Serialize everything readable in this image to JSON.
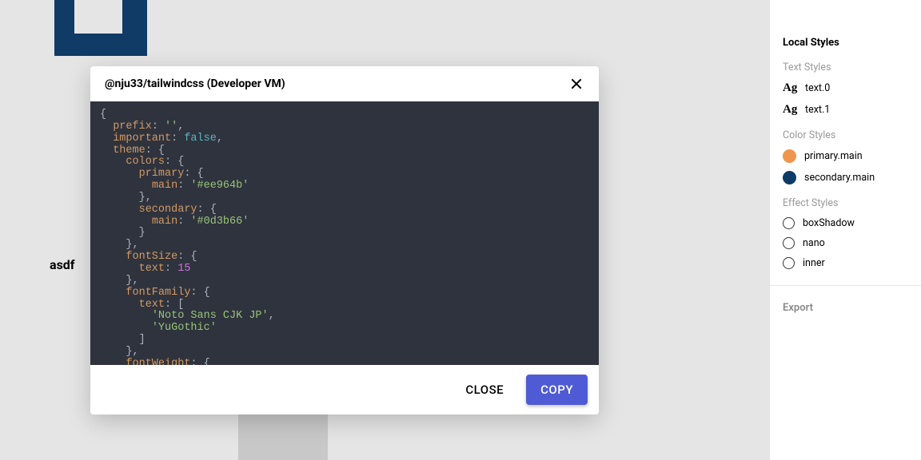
{
  "canvas": {
    "asdf_text": "asdf"
  },
  "modal": {
    "title": "@nju33/tailwindcss (Developer VM)",
    "close_btn": "CLOSE",
    "copy_btn": "COPY",
    "code": {
      "prefix_key": "prefix",
      "prefix_val": "''",
      "important_key": "important",
      "important_val": "false",
      "theme_key": "theme",
      "colors_key": "colors",
      "primary_key": "primary",
      "main_key": "main",
      "primary_main_val": "'#ee964b'",
      "secondary_key": "secondary",
      "secondary_main_val": "'#0d3b66'",
      "fontSize_key": "fontSize",
      "text_key": "text",
      "fontSize_text_val": "15",
      "fontFamily_key": "fontFamily",
      "fontFamily_text_0": "'Noto Sans CJK JP'",
      "fontFamily_text_1": "'YuGothic'",
      "fontWeight_key": "fontWeight"
    }
  },
  "sidebar": {
    "local_styles": "Local Styles",
    "text_styles": "Text Styles",
    "text0": "text.0",
    "text1": "text.1",
    "ag": "Ag",
    "color_styles": "Color Styles",
    "primary_main": "primary.main",
    "secondary_main": "secondary.main",
    "effect_styles": "Effect Styles",
    "boxShadow": "boxShadow",
    "nano": "nano",
    "inner": "inner",
    "export": "Export"
  },
  "colors": {
    "primary_main": "#ee964b",
    "secondary_main": "#0d3b66",
    "modal_primary_btn": "#4f5bd5"
  }
}
